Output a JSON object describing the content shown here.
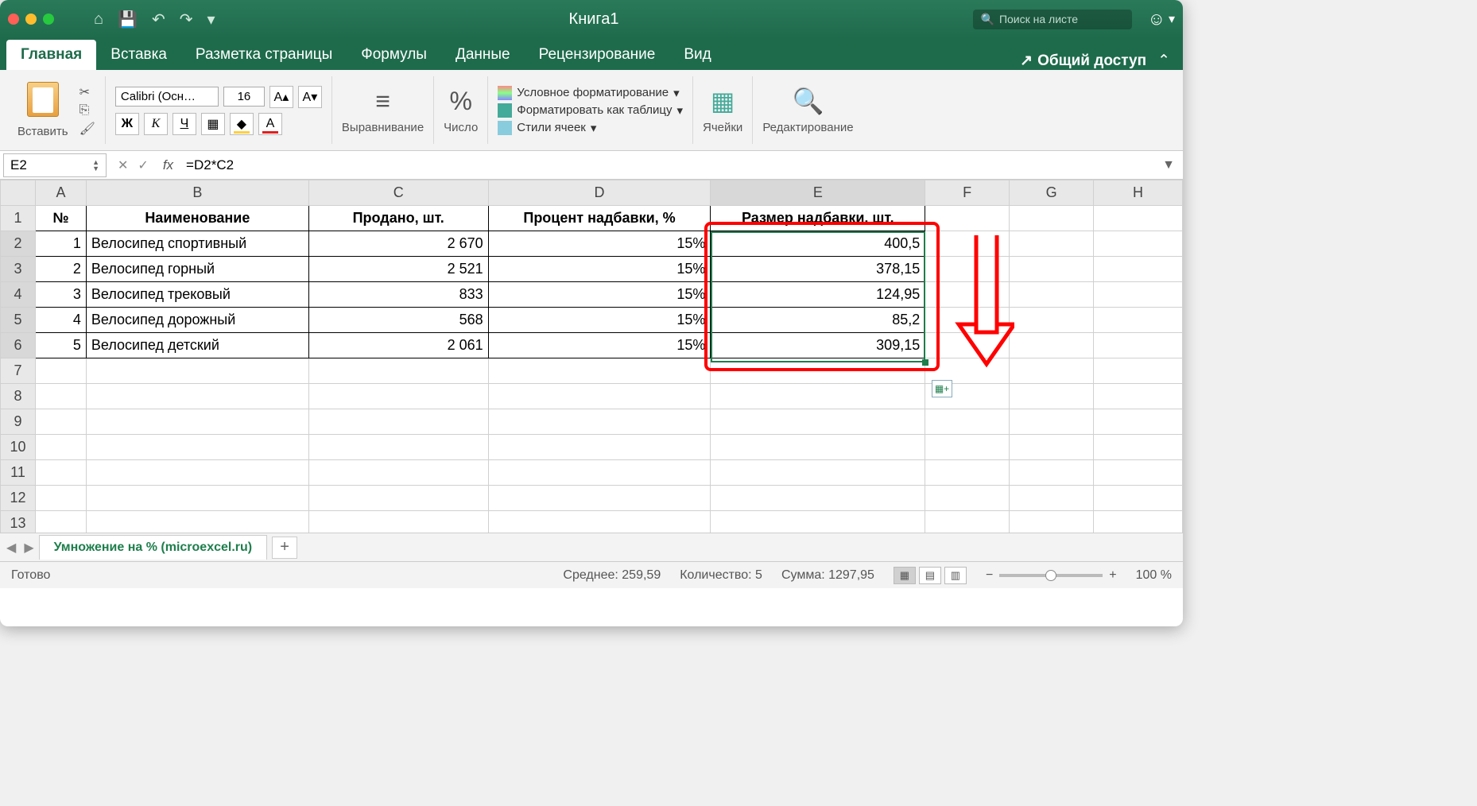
{
  "title": "Книга1",
  "search_placeholder": "Поиск на листе",
  "tabs": [
    "Главная",
    "Вставка",
    "Разметка страницы",
    "Формулы",
    "Данные",
    "Рецензирование",
    "Вид"
  ],
  "share_label": "Общий доступ",
  "ribbon": {
    "paste": "Вставить",
    "font_name": "Calibri (Осн…",
    "font_size": "16",
    "align": "Выравнивание",
    "number": "Число",
    "cond_fmt": "Условное форматирование",
    "fmt_table": "Форматировать как таблицу",
    "cell_styles": "Стили ячеек",
    "cells": "Ячейки",
    "editing": "Редактирование"
  },
  "name_box": "E2",
  "formula": "=D2*C2",
  "columns": [
    "A",
    "B",
    "C",
    "D",
    "E",
    "F",
    "G",
    "H"
  ],
  "headers": {
    "A": "№",
    "B": "Наименование",
    "C": "Продано, шт.",
    "D": "Процент надбавки, %",
    "E": "Размер надбавки, шт."
  },
  "rows": [
    {
      "n": "1",
      "name": "Велосипед спортивный",
      "sold": "2 670",
      "pct": "15%",
      "amt": "400,5"
    },
    {
      "n": "2",
      "name": "Велосипед горный",
      "sold": "2 521",
      "pct": "15%",
      "amt": "378,15"
    },
    {
      "n": "3",
      "name": "Велосипед трековый",
      "sold": "833",
      "pct": "15%",
      "amt": "124,95"
    },
    {
      "n": "4",
      "name": "Велосипед дорожный",
      "sold": "568",
      "pct": "15%",
      "amt": "85,2"
    },
    {
      "n": "5",
      "name": "Велосипед детский",
      "sold": "2 061",
      "pct": "15%",
      "amt": "309,15"
    }
  ],
  "sheet_tab": "Умножение на % (microexcel.ru)",
  "status": {
    "ready": "Готово",
    "avg": "Среднее: 259,59",
    "count": "Количество: 5",
    "sum": "Сумма: 1297,95",
    "zoom": "100 %"
  }
}
